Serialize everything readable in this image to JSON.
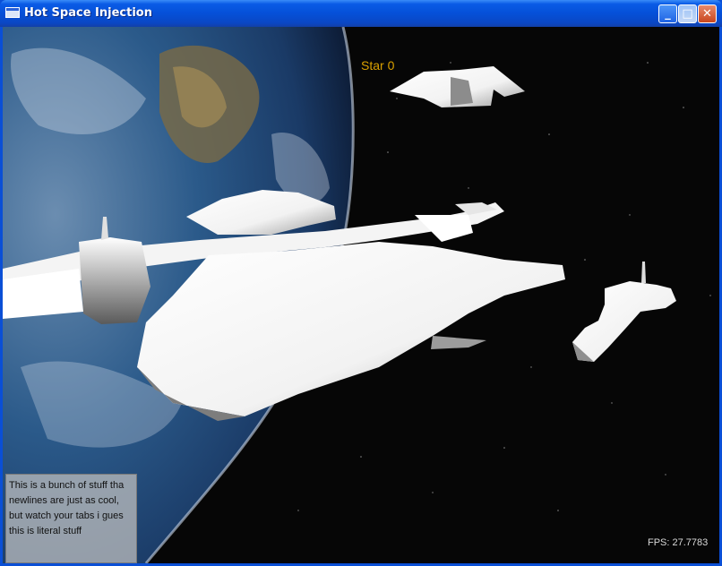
{
  "window": {
    "title": "Hot Space Injection",
    "buttons": {
      "minimize": "_",
      "maximize": "□",
      "close": "✕"
    }
  },
  "hud": {
    "star_label": "Star 0",
    "fps_label": "FPS: 27.7783",
    "text_lines": [
      "This is a bunch of stuff tha",
      "newlines are just as cool,",
      "but watch your tabs i gues",
      "this is literal stuff"
    ]
  },
  "colors": {
    "title_bar": "#0550d8",
    "star_label": "#d9a000",
    "fps_text": "#d8d8d8",
    "space": "#060606",
    "ocean": "#2b5a8a"
  },
  "scene": {
    "icons": [
      "planet-earth",
      "capital-ship",
      "small-ship",
      "cloud-ship"
    ]
  }
}
